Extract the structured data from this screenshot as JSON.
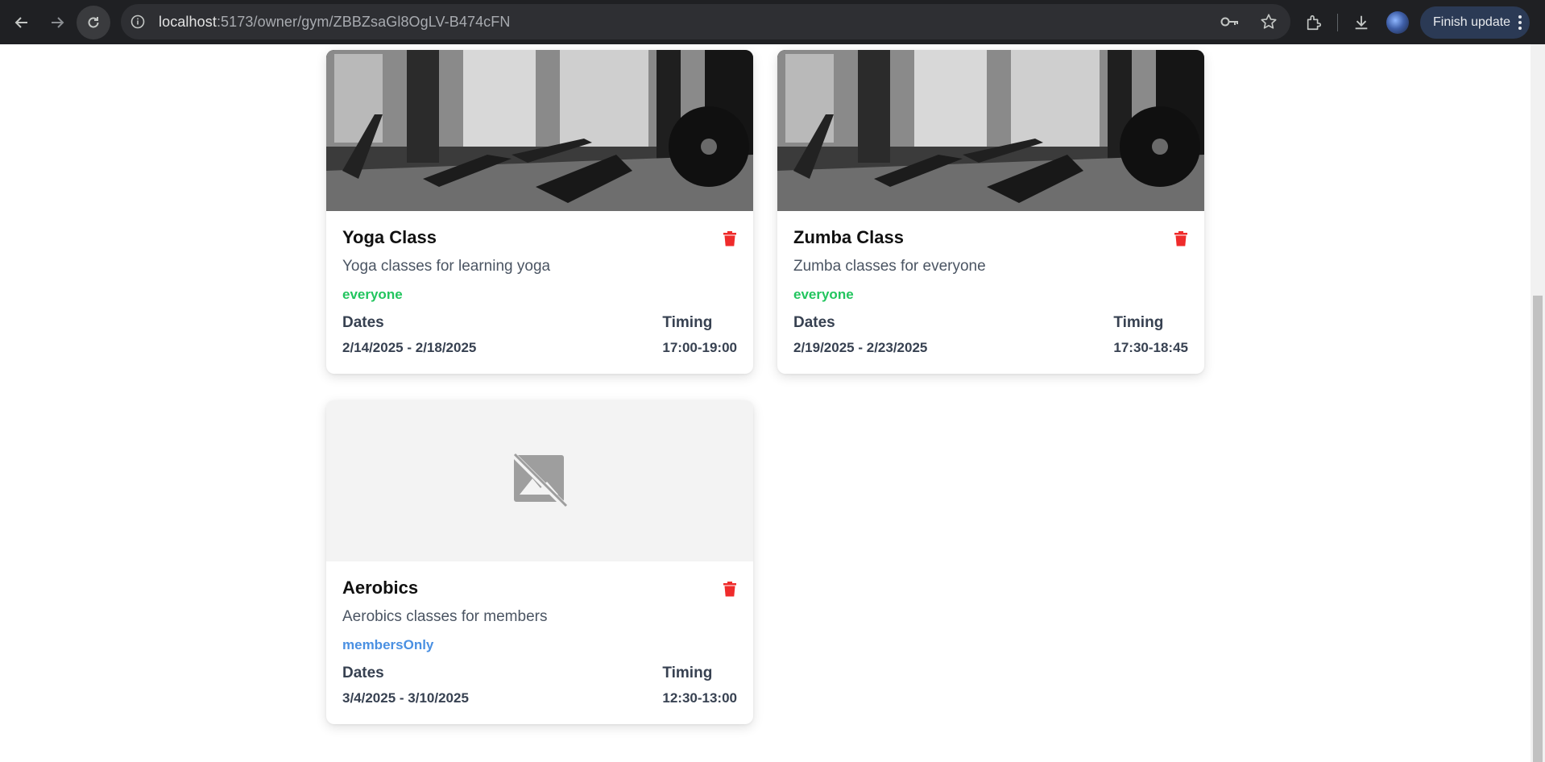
{
  "browser": {
    "url_host": "localhost",
    "url_path": ":5173/owner/gym/ZBBZsaGl8OgLV-B474cFN",
    "finish_update_label": "Finish update"
  },
  "cards": [
    {
      "title": "Yoga Class",
      "description": "Yoga classes for learning yoga",
      "audience": "everyone",
      "dates_label": "Dates",
      "dates_value": "2/14/2025 - 2/18/2025",
      "timing_label": "Timing",
      "timing_value": "17:00-19:00",
      "image": "gym-photo"
    },
    {
      "title": "Zumba Class",
      "description": "Zumba classes for everyone",
      "audience": "everyone",
      "dates_label": "Dates",
      "dates_value": "2/19/2025 - 2/23/2025",
      "timing_label": "Timing",
      "timing_value": "17:30-18:45",
      "image": "gym-photo"
    },
    {
      "title": "Aerobics",
      "description": "Aerobics classes for members",
      "audience": "membersOnly",
      "dates_label": "Dates",
      "dates_value": "3/4/2025 - 3/10/2025",
      "timing_label": "Timing",
      "timing_value": "12:30-13:00",
      "image": "image-unavailable-icon"
    }
  ],
  "colors": {
    "audience_everyone": "#22c55e",
    "audience_members": "#4a90e2",
    "delete": "#ef2b2b",
    "chrome_bg": "#1f2023"
  }
}
